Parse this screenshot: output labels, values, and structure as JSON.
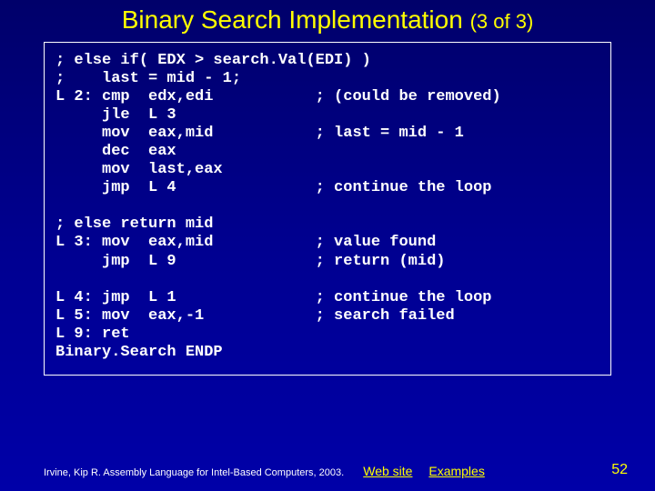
{
  "title": {
    "main": "Binary Search Implementation",
    "sub": "(3 of 3)"
  },
  "code": "; else if( EDX > search.Val(EDI) )\n;    last = mid - 1;\nL 2: cmp  edx,edi           ; (could be removed)\n     jle  L 3\n     mov  eax,mid           ; last = mid - 1\n     dec  eax\n     mov  last,eax\n     jmp  L 4               ; continue the loop\n\n; else return mid\nL 3: mov  eax,mid           ; value found\n     jmp  L 9               ; return (mid)\n\nL 4: jmp  L 1               ; continue the loop\nL 5: mov  eax,-1            ; search failed\nL 9: ret\nBinary.Search ENDP",
  "footer": {
    "citation": "Irvine, Kip R. Assembly Language for Intel-Based Computers, 2003.",
    "link1": "Web site",
    "link2": "Examples"
  },
  "pagenum": "52"
}
